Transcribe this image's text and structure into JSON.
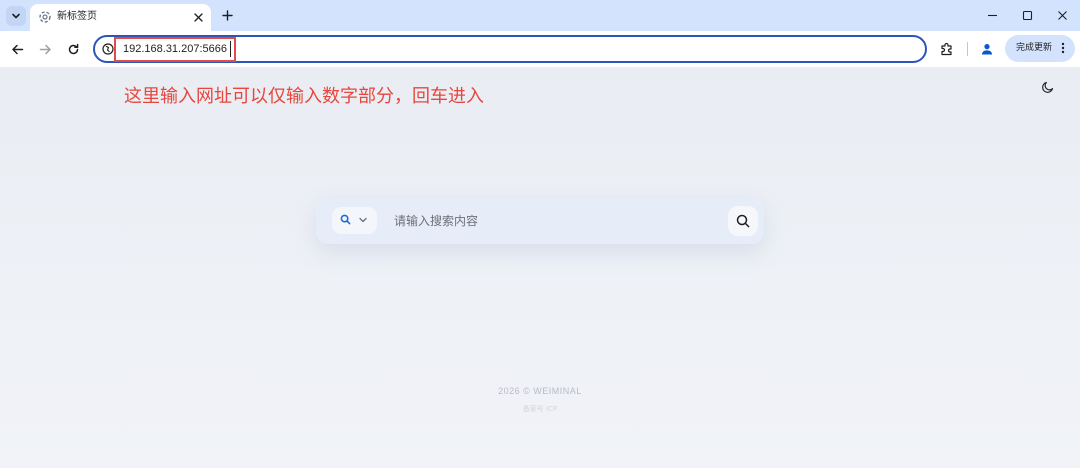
{
  "browser": {
    "tab": {
      "title": "新标签页"
    },
    "address_bar": {
      "url": "192.168.31.207:5666"
    },
    "update_button": {
      "label": "完成更新"
    },
    "colors": {
      "frame": "#d3e3fd",
      "omnibox_border": "#2c56b6",
      "highlight_box": "#e24b4b"
    },
    "icons": {
      "tab_search": "chevron-down-icon",
      "favicon": "loading-spinner-icon",
      "tab_close": "close-icon",
      "new_tab": "plus-icon",
      "minimize": "minimize-icon",
      "maximize": "maximize-icon",
      "close_window": "close-icon",
      "back": "arrow-left-icon",
      "forward": "arrow-right-icon",
      "reload": "reload-icon",
      "site_info": "globe-icon",
      "extensions": "puzzle-icon",
      "profile": "person-icon",
      "menu": "more-vert-icon"
    }
  },
  "page": {
    "annotation": "这里输入网址可以仅输入数字部分，回车进入",
    "annotation_color": "#e8463c",
    "theme_toggle_icon": "moon-icon",
    "search": {
      "engine_icon": "search-icon",
      "placeholder": "请输入搜索内容",
      "submit_icon": "search-icon"
    },
    "footer": {
      "copyright": "2026 © WEIMINAL",
      "subtext": "备案号 ICP"
    }
  }
}
